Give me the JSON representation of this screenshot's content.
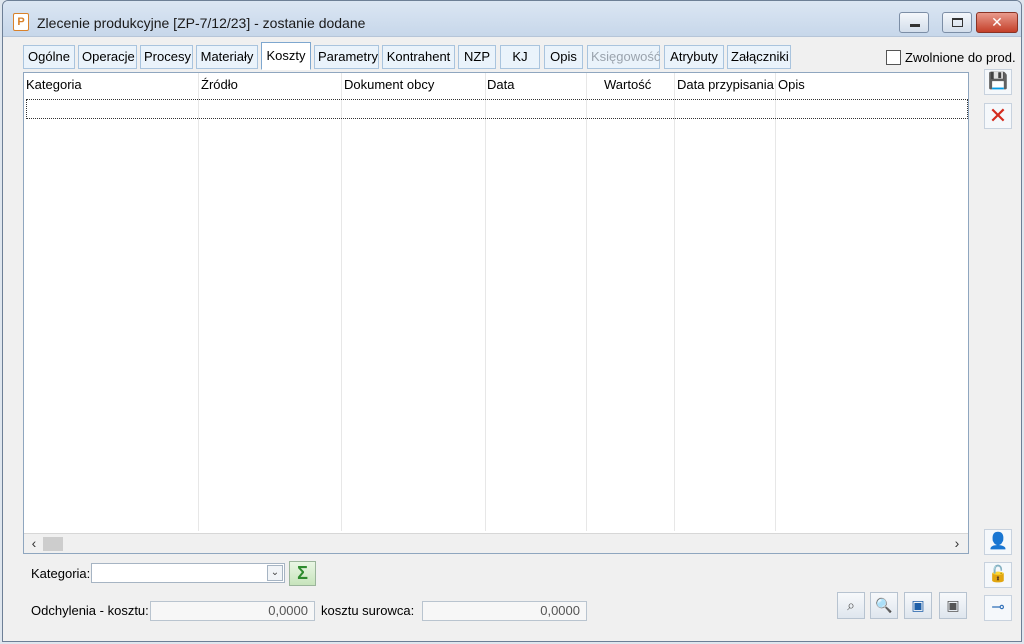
{
  "window": {
    "title": "Zlecenie produkcyjne  [ZP-7/12/23] - zostanie dodane",
    "app_icon_letter": "P"
  },
  "tabs": [
    {
      "label": "Ogólne",
      "state": "normal"
    },
    {
      "label": "Operacje",
      "state": "normal"
    },
    {
      "label": "Procesy",
      "state": "normal"
    },
    {
      "label": "Materiały",
      "state": "normal"
    },
    {
      "label": "Koszty",
      "state": "active"
    },
    {
      "label": "Parametry",
      "state": "normal"
    },
    {
      "label": "Kontrahent",
      "state": "normal"
    },
    {
      "label": "NZP",
      "state": "normal"
    },
    {
      "label": "KJ",
      "state": "normal"
    },
    {
      "label": "Opis",
      "state": "normal"
    },
    {
      "label": "Księgowość",
      "state": "disabled"
    },
    {
      "label": "Atrybuty",
      "state": "normal"
    },
    {
      "label": "Załączniki",
      "state": "normal"
    }
  ],
  "released_checkbox": {
    "label": "Zwolnione do prod.",
    "checked": false
  },
  "grid": {
    "columns": [
      "Kategoria",
      "Źródło",
      "Dokument obcy",
      "Data",
      "Wartość",
      "Data przypisania",
      "Opis"
    ],
    "rows": []
  },
  "footer": {
    "category_label": "Kategoria:",
    "category_value": "",
    "deviation_label": "Odchylenia - kosztu:",
    "deviation_value": "0,0000",
    "raw_cost_label": "kosztu surowca:",
    "raw_cost_value": "0,0000"
  },
  "icons": {
    "save": "save-icon",
    "delete": "delete-icon",
    "sum": "sigma-icon",
    "user_cost": "user-icon",
    "lock": "lock-icon",
    "pin": "pin-icon",
    "zoom_doc": "zoom-document-icon",
    "zoom": "zoom-icon",
    "book": "book-icon",
    "book_disabled": "book-disabled-icon"
  },
  "colors": {
    "delete": "#d42b1e",
    "sigma": "#2e8b2e",
    "accent": "#1f5fa8"
  }
}
